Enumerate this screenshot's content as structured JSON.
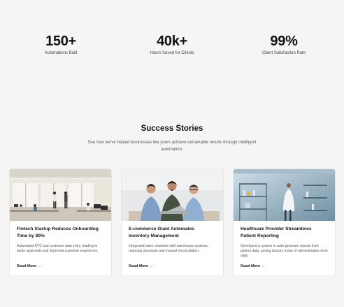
{
  "stats": [
    {
      "value": "150+",
      "label": "Automations Built"
    },
    {
      "value": "40k+",
      "label": "Hours Saved for Clients"
    },
    {
      "value": "99%",
      "label": "Client Satisfaction Rate"
    }
  ],
  "success": {
    "title": "Success Stories",
    "subtitle": "See how we've helped businesses like yours achieve remarkable results through intelligent automation."
  },
  "cards": [
    {
      "image": "office-workspace-photo",
      "title": "Fintech Startup Reduces Onboarding Time by 80%",
      "description": "Automated KYC and customer data entry, leading to faster approvals and improved customer experience.",
      "link": "Read More →"
    },
    {
      "image": "team-laptop-photo",
      "title": "E-commerce Giant Automates Inventory Management",
      "description": "Integrated sales channels with warehouse systems, reducing stockouts and manual reconciliation.",
      "link": "Read More →"
    },
    {
      "image": "laboratory-scientist-photo",
      "title": "Healthcare Provider Streamlines Patient Reporting",
      "description": "Developed a system to auto-generate reports from patient data, saving doctors hours of administrative work daily.",
      "link": "Read More →"
    }
  ]
}
